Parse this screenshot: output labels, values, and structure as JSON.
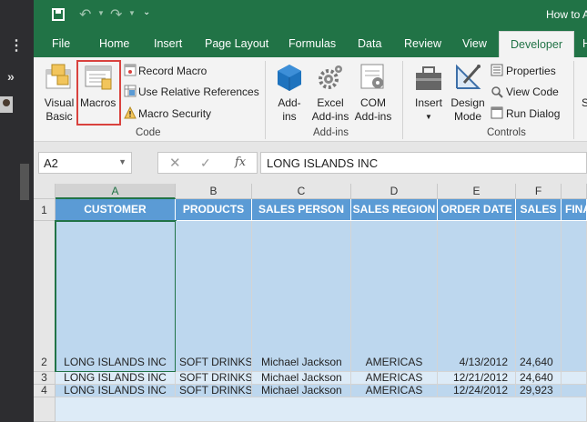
{
  "app": {
    "title": "How to A",
    "quick_access": {
      "save_icon": "save-icon",
      "undo_icon": "undo-icon",
      "redo_icon": "redo-icon"
    }
  },
  "tabs": [
    {
      "label": "File"
    },
    {
      "label": "Home"
    },
    {
      "label": "Insert"
    },
    {
      "label": "Page Layout"
    },
    {
      "label": "Formulas"
    },
    {
      "label": "Data"
    },
    {
      "label": "Review"
    },
    {
      "label": "View"
    },
    {
      "label": "Developer",
      "active": true
    },
    {
      "label": "H"
    }
  ],
  "ribbon": {
    "code": {
      "label": "Code",
      "visual_basic": [
        "Visual",
        "Basic"
      ],
      "macros": "Macros",
      "record_macro": "Record Macro",
      "use_relative": "Use Relative References",
      "macro_security": "Macro Security"
    },
    "addins": {
      "label": "Add-ins",
      "addins": [
        "Add-",
        "ins"
      ],
      "excel_addins": [
        "Excel",
        "Add-ins"
      ],
      "com_addins": [
        "COM",
        "Add-ins"
      ]
    },
    "controls": {
      "label": "Controls",
      "insert": "Insert",
      "design_mode": [
        "Design",
        "Mode"
      ],
      "properties": "Properties",
      "view_code": "View Code",
      "run_dialog": "Run Dialog"
    },
    "extra": "S"
  },
  "formula_bar": {
    "name_box": "A2",
    "cancel": "✕",
    "enter": "✓",
    "fx": "fx",
    "formula": "LONG ISLANDS INC"
  },
  "sheet": {
    "columns": [
      "A",
      "B",
      "C",
      "D",
      "E",
      "F"
    ],
    "rows": [
      "1",
      "2",
      "3",
      "4"
    ],
    "headers": [
      "CUSTOMER",
      "PRODUCTS",
      "SALES PERSON",
      "SALES REGION",
      "ORDER DATE",
      "SALES",
      "FINA"
    ],
    "data": [
      [
        "LONG ISLANDS INC",
        "SOFT DRINKS",
        "Michael Jackson",
        "AMERICAS",
        "4/13/2012",
        "24,640"
      ],
      [
        "LONG ISLANDS INC",
        "SOFT DRINKS",
        "Michael Jackson",
        "AMERICAS",
        "12/21/2012",
        "24,640"
      ],
      [
        "LONG ISLANDS INC",
        "SOFT DRINKS",
        "Michael Jackson",
        "AMERICAS",
        "12/24/2012",
        "29,923"
      ]
    ]
  },
  "colors": {
    "excel_green": "#217346",
    "header_blue": "#5b9bd5",
    "band_blue": "#bdd7ee",
    "highlight_red": "#d9423e"
  }
}
